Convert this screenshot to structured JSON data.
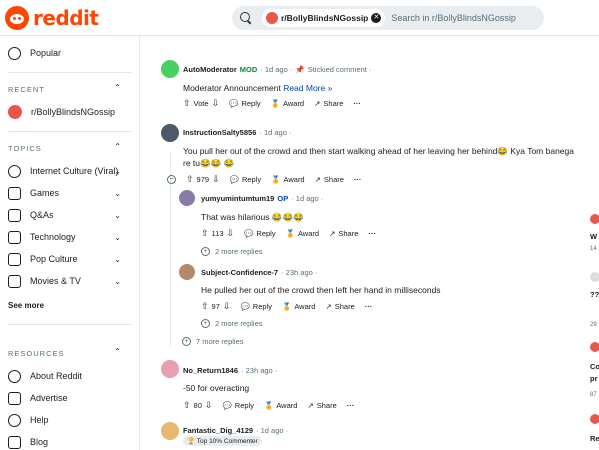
{
  "header": {
    "logo_text": "reddit",
    "search_chip": "r/BollyBlindsNGossip",
    "search_placeholder": "Search in r/BollyBlindsNGossip"
  },
  "sidebar": {
    "popular": "Popular",
    "recent_label": "RECENT",
    "recent_item": "r/BollyBlindsNGossip",
    "topics_label": "TOPICS",
    "topics": [
      "Internet Culture (Viral)",
      "Games",
      "Q&As",
      "Technology",
      "Pop Culture",
      "Movies & TV"
    ],
    "see_more": "See more",
    "resources_label": "RESOURCES",
    "resources": [
      "About Reddit",
      "Advertise",
      "Help",
      "Blog"
    ]
  },
  "comments": [
    {
      "author": "AutoModerator",
      "flair": "MOD",
      "time": "· 1d ago ·",
      "extra": "Stickied comment ·",
      "body": "Moderator Announcement",
      "link": "Read More »",
      "vote": "Vote",
      "reply": "Reply",
      "award": "Award",
      "share": "Share"
    },
    {
      "author": "InstructionSalty5856",
      "time": "· 1d ago ·",
      "body": "You pull her out of the crowd and then start walking ahead of her leaving her behind😂 Kya Tom banega re tu😂😂 😂",
      "score": "979",
      "reply": "Reply",
      "award": "Award",
      "share": "Share"
    },
    {
      "author": "yumyumintumtum19",
      "flair": "OP",
      "time": "· 1d ago ·",
      "body": "That was hilarious 😂😂😂",
      "score": "113",
      "reply": "Reply",
      "award": "Award",
      "share": "Share",
      "more": "2 more replies"
    },
    {
      "author": "Subject-Confidence-7",
      "time": "· 23h ago ·",
      "body": "He pulled her out of the crowd then left her hand in milliseconds",
      "score": "97",
      "reply": "Reply",
      "award": "Award",
      "share": "Share",
      "more": "2 more replies"
    },
    {
      "more": "7 more replies"
    },
    {
      "author": "No_Return1846",
      "time": "· 23h ago ·",
      "body": "-50 for overacting",
      "score": "80",
      "reply": "Reply",
      "award": "Award",
      "share": "Share"
    },
    {
      "author": "Fantastic_Dig_4129",
      "time": "· 1d ago ·",
      "badge": "🏆 Top 10% Commenter"
    }
  ],
  "right_column": {
    "items": [
      "W",
      "14",
      "??",
      "29",
      "Co",
      "pr",
      "87",
      "Re"
    ]
  },
  "colors": {
    "brand": "#ff4500",
    "mod": "#0a8a3a",
    "op": "#0045ac"
  }
}
